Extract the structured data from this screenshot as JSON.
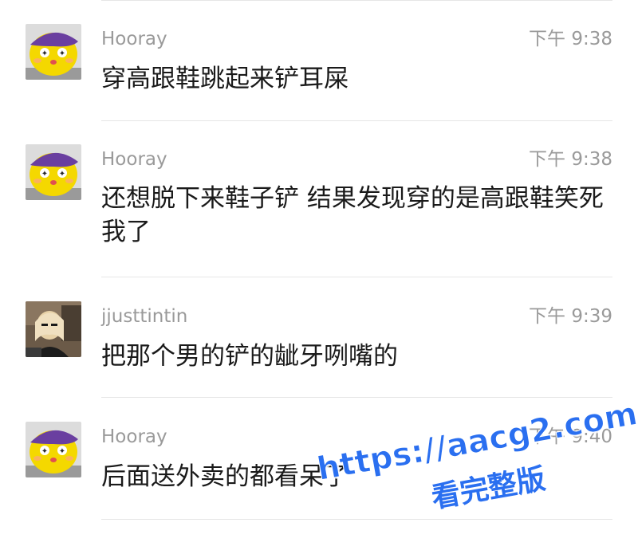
{
  "messages": [
    {
      "sender": "Hooray",
      "time": "下午 9:38",
      "text": "穿高跟鞋跳起来铲耳屎",
      "avatar": "yellow-cartoon-avatar"
    },
    {
      "sender": "Hooray",
      "time": "下午 9:38",
      "text": "还想脱下来鞋子铲 结果发现穿的是高跟鞋笑死我了",
      "avatar": "yellow-cartoon-avatar"
    },
    {
      "sender": "jjusttintin",
      "time": "下午 9:39",
      "text": "把那个男的铲的龇牙咧嘴的",
      "avatar": "photo-avatar"
    },
    {
      "sender": "Hooray",
      "time": "下午 9:40",
      "text": "后面送外卖的都看呆了",
      "avatar": "yellow-cartoon-avatar"
    }
  ],
  "watermark": {
    "line1": "https://aacg2.com",
    "line2": "看完整版",
    "color": "#2a6ff0"
  }
}
